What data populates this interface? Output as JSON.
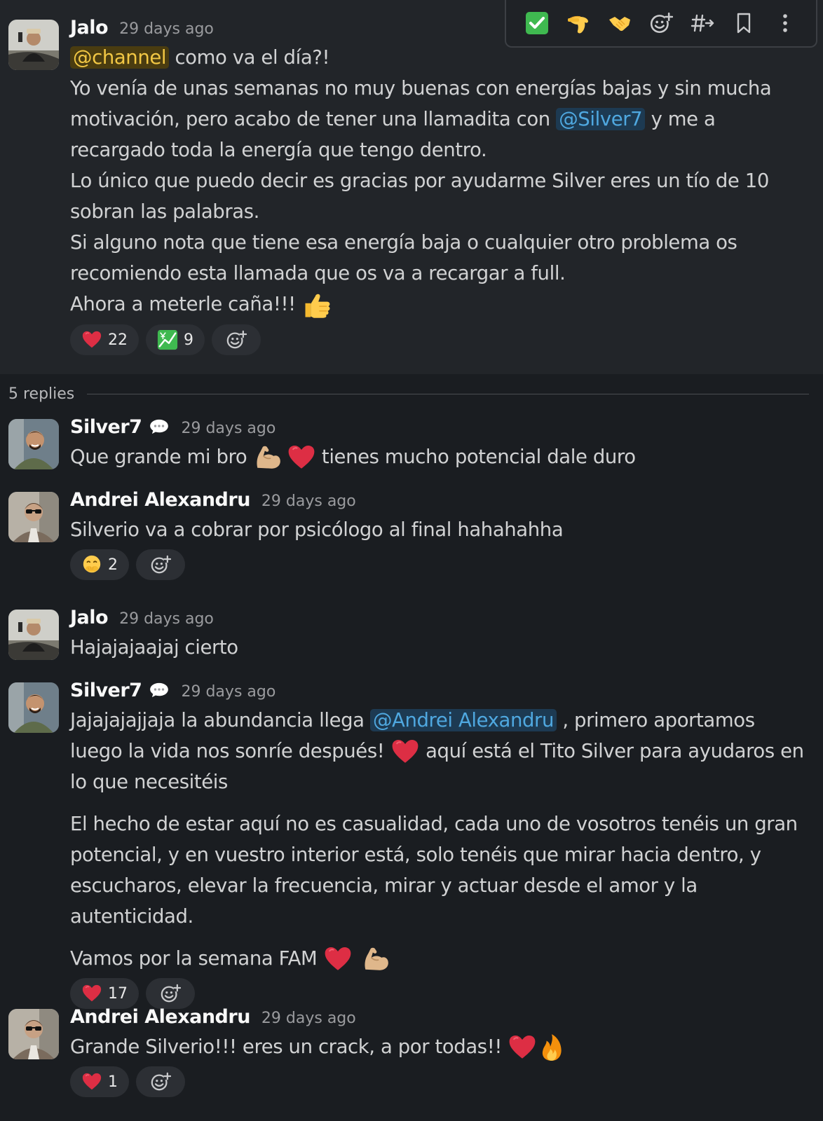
{
  "thread": {
    "parent": {
      "author": "Jalo",
      "time": "29 days ago",
      "mention_channel": "@channel",
      "line1_rest": " como va el día?!",
      "line2": "Yo venía de unas semanas no muy buenas con energías bajas y sin mucha motivación, pero acabo de tener una llamadita con ",
      "mention_user": "@Silver7",
      "line2_rest": " y me a recargado toda la energía que tengo dentro.",
      "line3": "Lo único que puedo decir es gracias por ayudarme Silver eres un tío de 10 sobran las palabras.",
      "line4": "Si alguno nota que tiene esa energía baja o cualquier otro problema os recomiendo esta llamada que os va a recargar a full.",
      "line5": "Ahora a meterle caña!!! ",
      "reactions": [
        {
          "icon": "heart-icon",
          "count": "22"
        },
        {
          "icon": "chart-yen-icon",
          "count": "9"
        }
      ]
    },
    "replies_label": "5 replies",
    "replies": [
      {
        "author": "Silver7",
        "time": "29 days ago",
        "text1": "Que grande mi bro ",
        "text2": "  tienes mucho potencial dale duro"
      },
      {
        "author": "Andrei Alexandru",
        "time": "29 days ago",
        "text": "Silverio va a cobrar por psicólogo al final hahahahha",
        "reactions": [
          {
            "icon": "face-hand-over-mouth-icon",
            "count": "2"
          }
        ]
      },
      {
        "author": "Jalo",
        "time": "29 days ago",
        "text": "Hajajajaajaj cierto"
      },
      {
        "author": "Silver7",
        "time": "29 days ago",
        "p1_a": "Jajajajajjaja la abundancia llega ",
        "p1_mention": "@Andrei Alexandru",
        "p1_b": " , primero aportamos luego la vida nos sonríe después! ",
        "p1_c": "  aquí está el Tito Silver para ayudaros en lo que necesitéis",
        "p2": "El hecho de estar aquí no es casualidad, cada uno de vosotros tenéis un gran potencial, y en vuestro interior está, solo tenéis que mirar hacia dentro, y escucharos, elevar la frecuencia, mirar y actuar desde el amor y la autenticidad.",
        "p3": "Vamos por la semana FAM ",
        "reactions": [
          {
            "icon": "heart-icon",
            "count": "17"
          }
        ]
      },
      {
        "author": "Andrei Alexandru",
        "time": "29 days ago",
        "text": "Grande Silverio!!! eres un crack, a por todas!! ",
        "reactions": [
          {
            "icon": "heart-icon",
            "count": "1"
          }
        ]
      }
    ]
  },
  "toolbar": [
    "check-mark-icon",
    "salute-icon",
    "handshake-icon",
    "add-reaction-icon",
    "reply-in-channel-icon",
    "bookmark-icon",
    "more-actions-icon"
  ],
  "colors": {
    "background": "#1a1d21",
    "parent_background": "#222529",
    "mention": "#4fa8e0",
    "channel_mention": "#f2c744"
  }
}
